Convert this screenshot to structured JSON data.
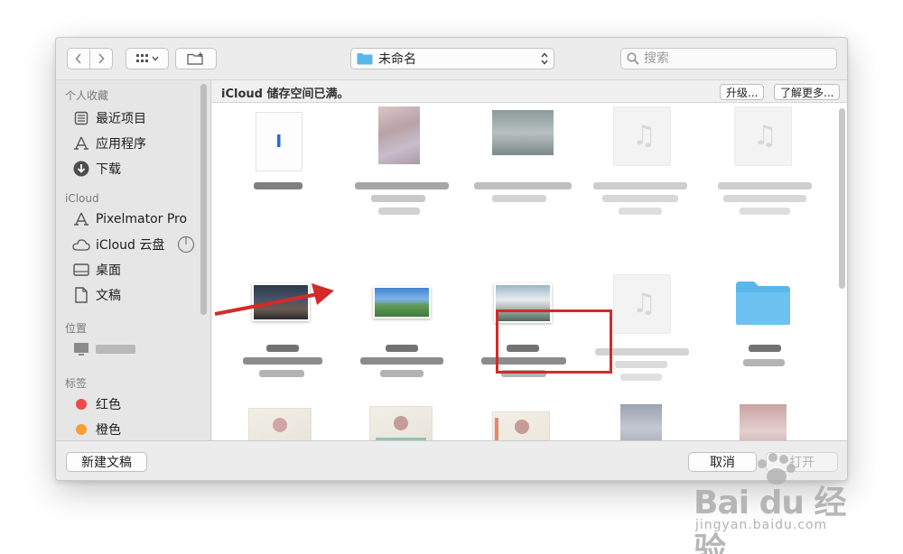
{
  "toolbar": {
    "location": "未命名",
    "search_placeholder": "搜索"
  },
  "sidebar": {
    "sections": [
      {
        "title": "个人收藏",
        "items": [
          {
            "label": "最近项目",
            "icon": "recents-icon"
          },
          {
            "label": "应用程序",
            "icon": "applications-icon"
          },
          {
            "label": "下载",
            "icon": "downloads-icon"
          }
        ]
      },
      {
        "title": "iCloud",
        "items": [
          {
            "label": "Pixelmator Pro",
            "icon": "pixelmator-icon"
          },
          {
            "label": "iCloud 云盘",
            "icon": "icloud-icon"
          },
          {
            "label": "桌面",
            "icon": "desktop-icon"
          },
          {
            "label": "文稿",
            "icon": "documents-icon"
          }
        ]
      },
      {
        "title": "位置",
        "items": [
          {
            "label": "",
            "icon": "computer-icon"
          }
        ]
      },
      {
        "title": "标签",
        "items": [
          {
            "label": "红色",
            "icon": "tag-red-icon",
            "color": "#ee4b4b"
          },
          {
            "label": "橙色",
            "icon": "tag-orange-icon",
            "color": "#f5a033"
          }
        ]
      }
    ]
  },
  "banner": {
    "message": "iCloud 储存空间已满。",
    "upgrade_label": "升级...",
    "learn_more_label": "了解更多..."
  },
  "footer": {
    "new_document_label": "新建文稿",
    "cancel_label": "取消",
    "open_label": "打开"
  },
  "colors": {
    "highlight": "#d42a2a",
    "folder": "#5ab7ec",
    "accent_blue": "#1f6fd1"
  },
  "watermark": {
    "brand": "Bai du 经验",
    "url": "jingyan.baidu.com"
  }
}
